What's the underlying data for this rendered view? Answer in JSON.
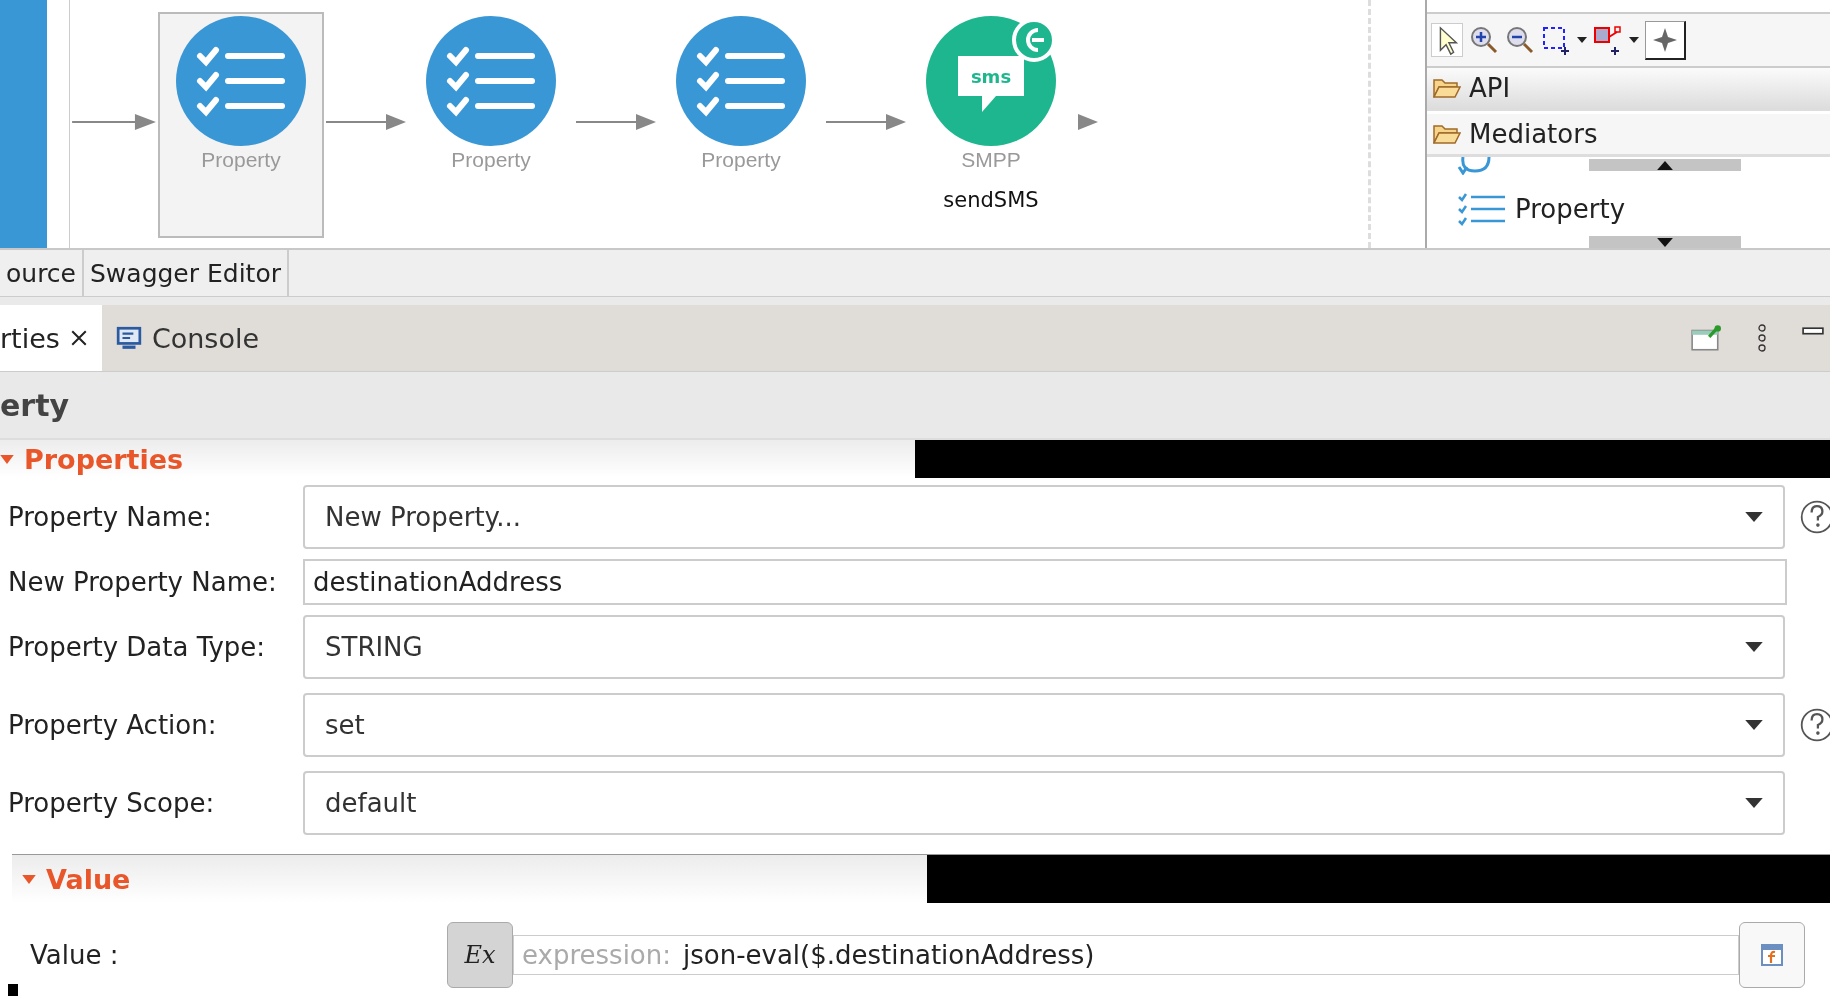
{
  "diagram": {
    "nodes": [
      {
        "label": "Property",
        "kind": "property",
        "selected": true
      },
      {
        "label": "Property",
        "kind": "property",
        "selected": false
      },
      {
        "label": "Property",
        "kind": "property",
        "selected": false
      },
      {
        "label": "SMPP",
        "kind": "smpp",
        "selected": false,
        "caption": "sendSMS",
        "icon_text": "sms"
      }
    ]
  },
  "palette": {
    "groups": [
      {
        "label": "API"
      },
      {
        "label": "Mediators"
      }
    ],
    "items": [
      {
        "label": "Property"
      }
    ]
  },
  "editor_tabs": [
    {
      "label": "ource"
    },
    {
      "label": "Swagger Editor"
    }
  ],
  "view_tabs": [
    {
      "label": "rties",
      "selected": true,
      "closable": true,
      "kind": "properties"
    },
    {
      "label": "Console",
      "selected": false,
      "kind": "console"
    }
  ],
  "view_title": "erty",
  "sections": [
    {
      "title": "Properties",
      "expanded": true,
      "fields": [
        {
          "label": "Property Name:",
          "kind": "dropdown",
          "value": "New Property...",
          "help": true
        },
        {
          "label": "New Property Name:",
          "kind": "text",
          "value": "destinationAddress"
        },
        {
          "label": "Property Data Type:",
          "kind": "dropdown",
          "value": "STRING"
        },
        {
          "label": "Property Action:",
          "kind": "dropdown",
          "value": "set",
          "help": true
        },
        {
          "label": "Property Scope:",
          "kind": "dropdown",
          "value": "default"
        }
      ]
    },
    {
      "title": "Value",
      "expanded": true,
      "fields": [
        {
          "label": "Value :",
          "kind": "expression",
          "prefix": "expression:",
          "value": "json-eval($.destinationAddress)",
          "button_text": "Ex"
        }
      ]
    }
  ]
}
